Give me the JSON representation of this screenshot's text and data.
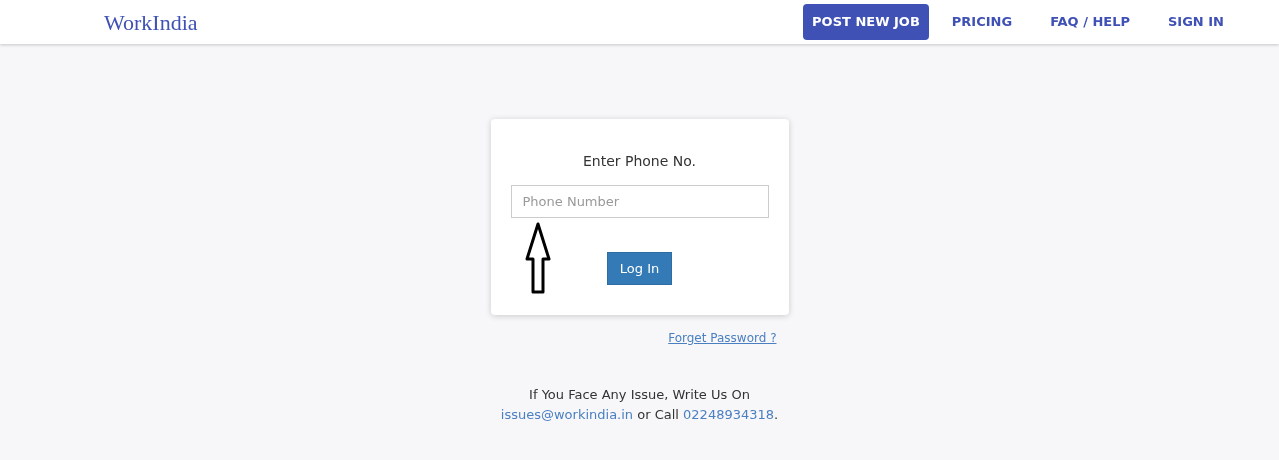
{
  "header": {
    "logo": "WorkIndia",
    "nav": [
      {
        "label": "POST NEW JOB",
        "kind": "primary"
      },
      {
        "label": "PRICING",
        "kind": "link"
      },
      {
        "label": "FAQ / HELP",
        "kind": "link"
      },
      {
        "label": "SIGN IN",
        "kind": "link"
      }
    ]
  },
  "login_card": {
    "title": "Enter Phone No.",
    "phone_field": {
      "placeholder": "Phone Number"
    },
    "login_button": "Log In"
  },
  "forgot_link": "Forget Password ?",
  "footer": {
    "line_1": "If You Face Any Issue, Write Us On",
    "email": "issues@workindia.in",
    "middle": " or Call ",
    "phone": "02248934318",
    "end": "."
  }
}
